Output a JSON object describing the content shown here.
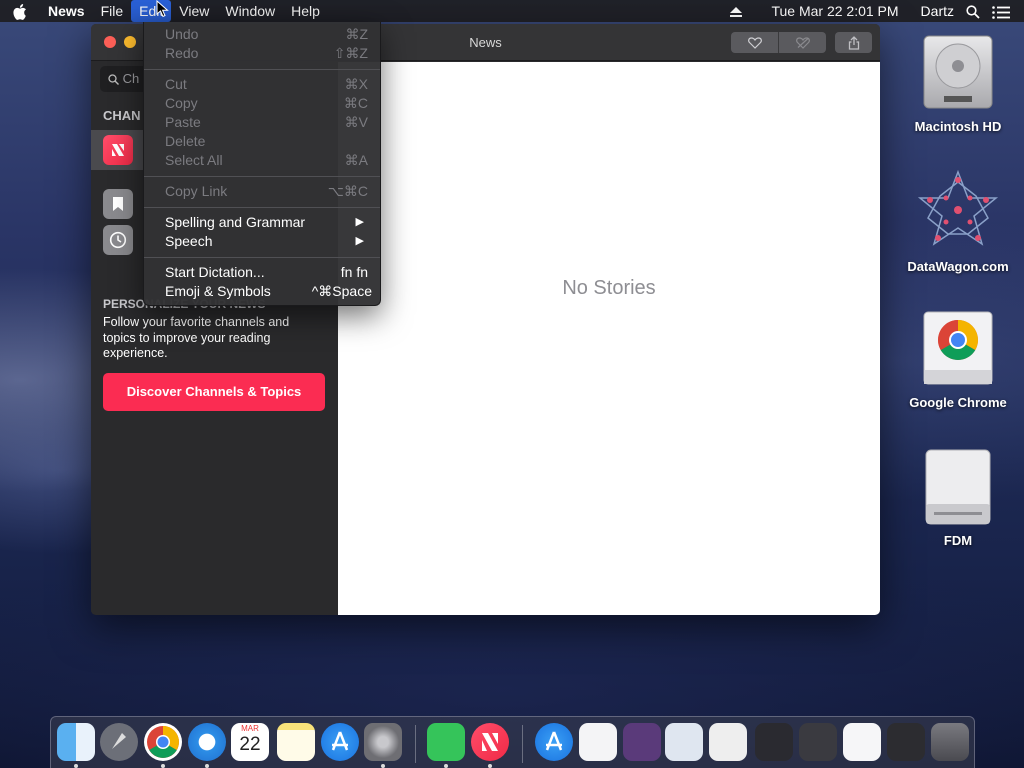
{
  "menubar": {
    "app": "News",
    "items": [
      "File",
      "Edit",
      "View",
      "Window",
      "Help"
    ],
    "datetime": "Tue Mar 22  2:01 PM",
    "user": "Dartz"
  },
  "window": {
    "title": "News",
    "search_placeholder": "Ch",
    "channels_header": "CHAN",
    "personalize_header": "PERSONALIZE YOUR NEWS",
    "personalize_text": "Follow your favorite channels and topics to improve your reading experience.",
    "discover_button": "Discover Channels & Topics",
    "no_stories": "No Stories"
  },
  "edit_menu": {
    "undo": {
      "label": "Undo",
      "shortcut": "⌘Z"
    },
    "redo": {
      "label": "Redo",
      "shortcut": "⇧⌘Z"
    },
    "cut": {
      "label": "Cut",
      "shortcut": "⌘X"
    },
    "copy": {
      "label": "Copy",
      "shortcut": "⌘C"
    },
    "paste": {
      "label": "Paste",
      "shortcut": "⌘V"
    },
    "delete": {
      "label": "Delete",
      "shortcut": ""
    },
    "select_all": {
      "label": "Select All",
      "shortcut": "⌘A"
    },
    "copy_link": {
      "label": "Copy Link",
      "shortcut": "⌥⌘C"
    },
    "spelling": {
      "label": "Spelling and Grammar"
    },
    "speech": {
      "label": "Speech"
    },
    "dictation": {
      "label": "Start Dictation...",
      "shortcut": "fn fn"
    },
    "emoji": {
      "label": "Emoji & Symbols",
      "shortcut": "^⌘Space"
    }
  },
  "desktop": {
    "hd": "Macintosh HD",
    "datawagon": "DataWagon.com",
    "chrome": "Google Chrome",
    "fdm": "FDM"
  },
  "dock_date": {
    "month": "MAR",
    "day": "22"
  },
  "colors": {
    "accent": "#2b62d9",
    "news_red": "#fb2c52"
  }
}
